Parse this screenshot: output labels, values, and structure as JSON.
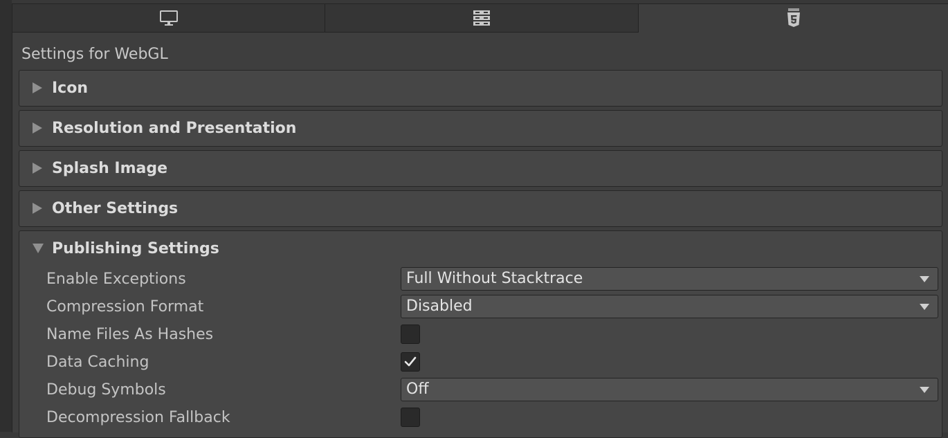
{
  "tabs": [
    {
      "icon": "monitor-icon",
      "active": false
    },
    {
      "icon": "server-icon",
      "active": false
    },
    {
      "icon": "html5-icon",
      "active": true
    }
  ],
  "settings_title": "Settings for WebGL",
  "sections": {
    "icon": "Icon",
    "resolution": "Resolution and Presentation",
    "splash": "Splash Image",
    "other": "Other Settings",
    "publishing": "Publishing Settings"
  },
  "publishing": {
    "enable_exceptions": {
      "label": "Enable Exceptions",
      "value": "Full Without Stacktrace"
    },
    "compression_format": {
      "label": "Compression Format",
      "value": "Disabled"
    },
    "name_files_as_hashes": {
      "label": "Name Files As Hashes",
      "checked": false
    },
    "data_caching": {
      "label": "Data Caching",
      "checked": true
    },
    "debug_symbols": {
      "label": "Debug Symbols",
      "value": "Off"
    },
    "decompression_fallback": {
      "label": "Decompression Fallback",
      "checked": false
    }
  },
  "colors": {
    "background": "#3e3e3e",
    "foldout": "#464646",
    "field": "#515151",
    "checkbox": "#2a2a2a",
    "text": "#c4c4c4"
  }
}
